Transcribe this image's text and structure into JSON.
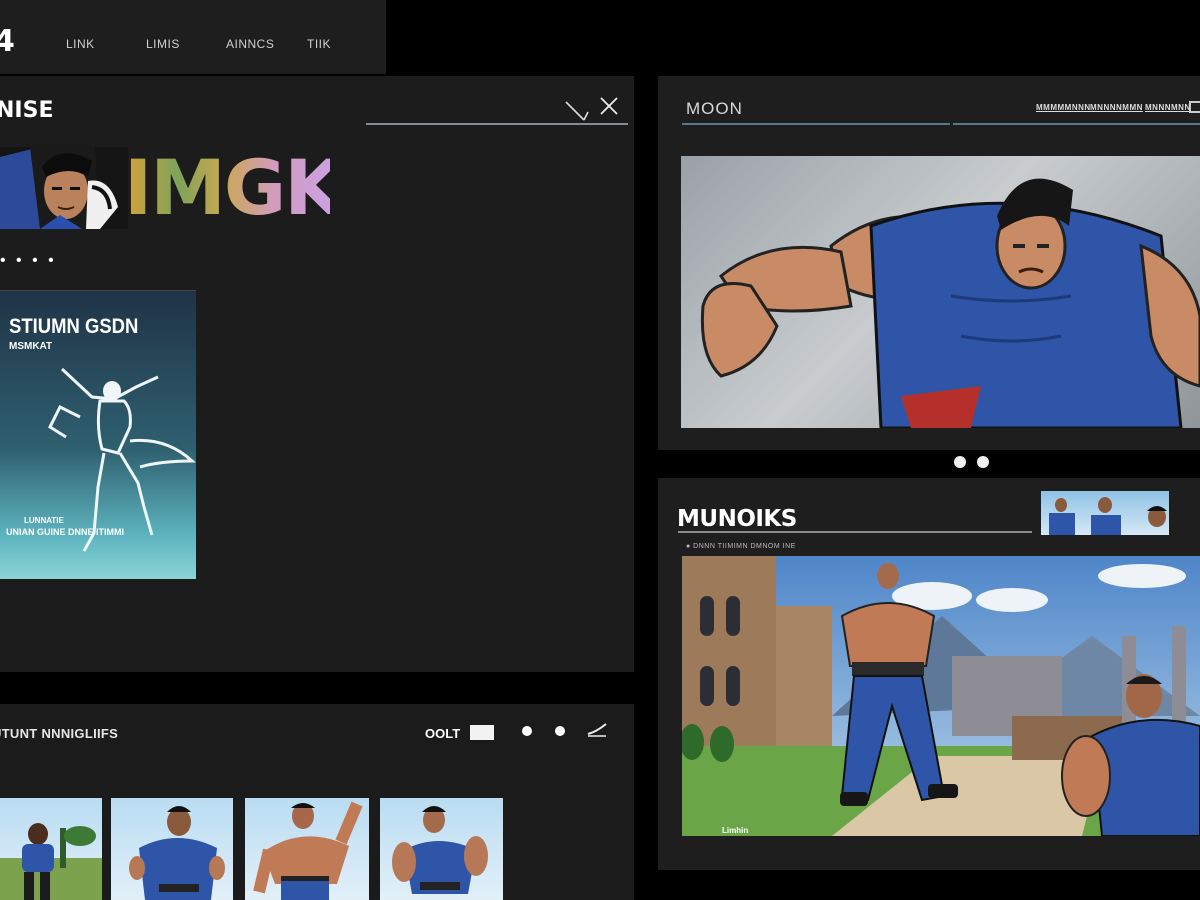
{
  "header": {
    "logo": "4",
    "nav": [
      "LINK",
      "LIMIS",
      "AINNCS",
      "TIIK"
    ]
  },
  "main": {
    "section_title": "NISE",
    "banner_text": "IMGK",
    "banner_dots": "• • • •",
    "poster": {
      "title": "STIUMN GSDN",
      "subtitle": "MSMKAT",
      "credit_top": "LUNNATIE",
      "credit_bottom": "UNIAN  GUINE  DNNE  ITIMMI"
    }
  },
  "gallery": {
    "title": "UTUNT NNNIGLIIFS",
    "sort_label": "OOLT"
  },
  "featured": {
    "title": "MOON",
    "tabs": [
      "MMMMMNNN",
      "MNNNNMMN",
      "MNNNMNN"
    ]
  },
  "monuments": {
    "title": "MUNOIKS",
    "meta": "●    DNNN   TIIMIMN   DMNOM   INE",
    "caption": "Limhin"
  },
  "colors": {
    "background": "#000000",
    "panel": "#1c1c1c",
    "accent_line": "#5b7687",
    "costume_blue": "#2f55a8",
    "skin": "#c98a66"
  },
  "icons": [
    "search-icon",
    "close-icon",
    "edit-icon",
    "expand-icon"
  ]
}
